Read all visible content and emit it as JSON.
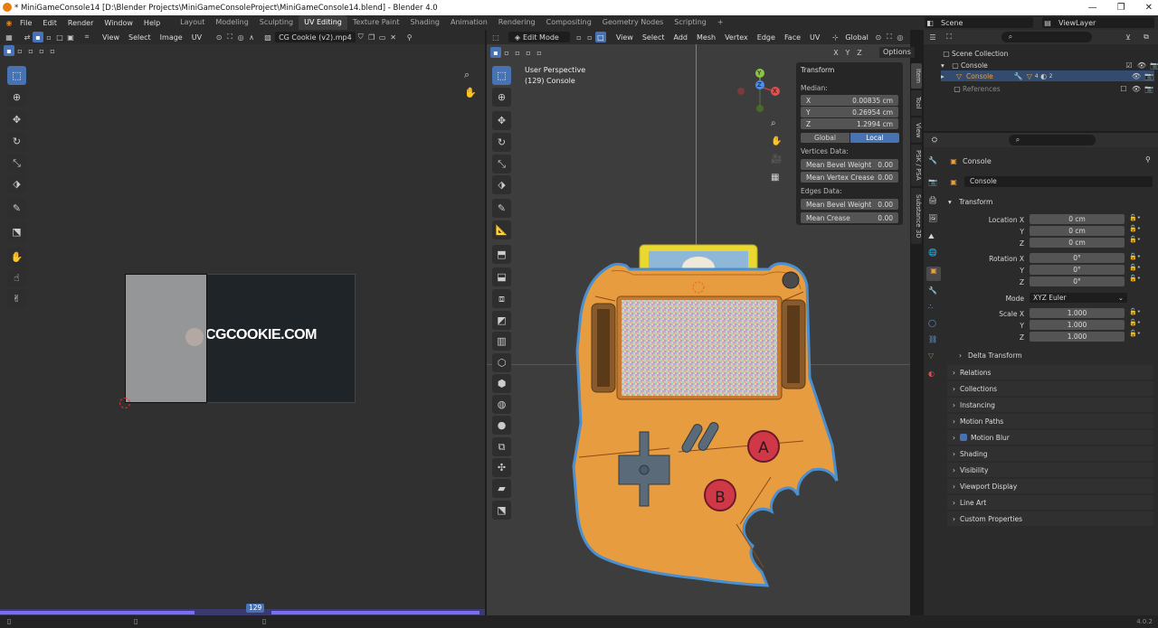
{
  "window": {
    "title": "* MiniGameConsole14 [D:\\Blender Projects\\MiniGameConsoleProject\\MiniGameConsole14.blend] - Blender 4.0"
  },
  "menu": [
    "File",
    "Edit",
    "Render",
    "Window",
    "Help"
  ],
  "workspaces": [
    "Layout",
    "Modeling",
    "Sculpting",
    "UV Editing",
    "Texture Paint",
    "Shading",
    "Animation",
    "Rendering",
    "Compositing",
    "Geometry Nodes",
    "Scripting"
  ],
  "workspace_add": "+",
  "scene": {
    "name": "Scene",
    "viewlayer": "ViewLayer"
  },
  "uv_header": {
    "view": "View",
    "select": "Select",
    "image": "Image",
    "uv": "UV",
    "image_name": "CG Cookie (v2).mp4"
  },
  "uv_image": {
    "logo_text": "CGCOOKIE.COM"
  },
  "vp_header": {
    "mode": "Edit Mode",
    "view": "View",
    "select": "Select",
    "add": "Add",
    "mesh": "Mesh",
    "vertex": "Vertex",
    "edge": "Edge",
    "face": "Face",
    "uv": "UV",
    "orientation": "Global",
    "options": "Options",
    "x": "X",
    "y": "Y",
    "z": "Z"
  },
  "viewport": {
    "perspective": "User Perspective",
    "object": "(129) Console",
    "gizmo_x": "X",
    "gizmo_y": "Y",
    "gizmo_z": "Z",
    "btn_a": "A",
    "btn_b": "B"
  },
  "npanel": {
    "title": "Transform",
    "median": "Median:",
    "x_label": "X",
    "x": "0.00835 cm",
    "y_label": "Y",
    "y": "0.26954 cm",
    "z_label": "Z",
    "z": "1.2994 cm",
    "global": "Global",
    "local": "Local",
    "vertices_data": "Vertices Data:",
    "mean_bevel_weight": "Mean Bevel Weight",
    "mbw_v": "0.00",
    "mean_vertex_crease": "Mean Vertex Crease",
    "mvc_v": "0.00",
    "edges_data": "Edges Data:",
    "mean_bevel_weight_e": "Mean Bevel Weight",
    "mbw_e": "0.00",
    "mean_crease": "Mean Crease",
    "mc_v": "0.00",
    "tabs": [
      "Item",
      "Tool",
      "View",
      "PSK / PSA",
      "Substance 3D"
    ]
  },
  "outliner": {
    "scene_collection": "Scene Collection",
    "console_collection": "Console",
    "console_obj": "Console",
    "references": "References",
    "modifier_count": "4",
    "mat_count": "2"
  },
  "properties": {
    "object_name": "Console",
    "data_name": "Console",
    "transform": "Transform",
    "location_x_label": "Location X",
    "location_y_label": "Y",
    "location_z_label": "Z",
    "loc_x": "0 cm",
    "loc_y": "0 cm",
    "loc_z": "0 cm",
    "rotation_x_label": "Rotation X",
    "rotation_y_label": "Y",
    "rotation_z_label": "Z",
    "rot_x": "0°",
    "rot_y": "0°",
    "rot_z": "0°",
    "mode_label": "Mode",
    "mode": "XYZ Euler",
    "scale_x_label": "Scale X",
    "scale_y_label": "Y",
    "scale_z_label": "Z",
    "scale_x": "1.000",
    "scale_y": "1.000",
    "scale_z": "1.000",
    "delta": "Delta Transform",
    "sections": [
      "Relations",
      "Collections",
      "Instancing",
      "Motion Paths",
      "Motion Blur",
      "Shading",
      "Visibility",
      "Viewport Display",
      "Line Art",
      "Custom Properties"
    ]
  },
  "timeline": {
    "frame": "129"
  },
  "status": {
    "version": "4.0.2"
  }
}
